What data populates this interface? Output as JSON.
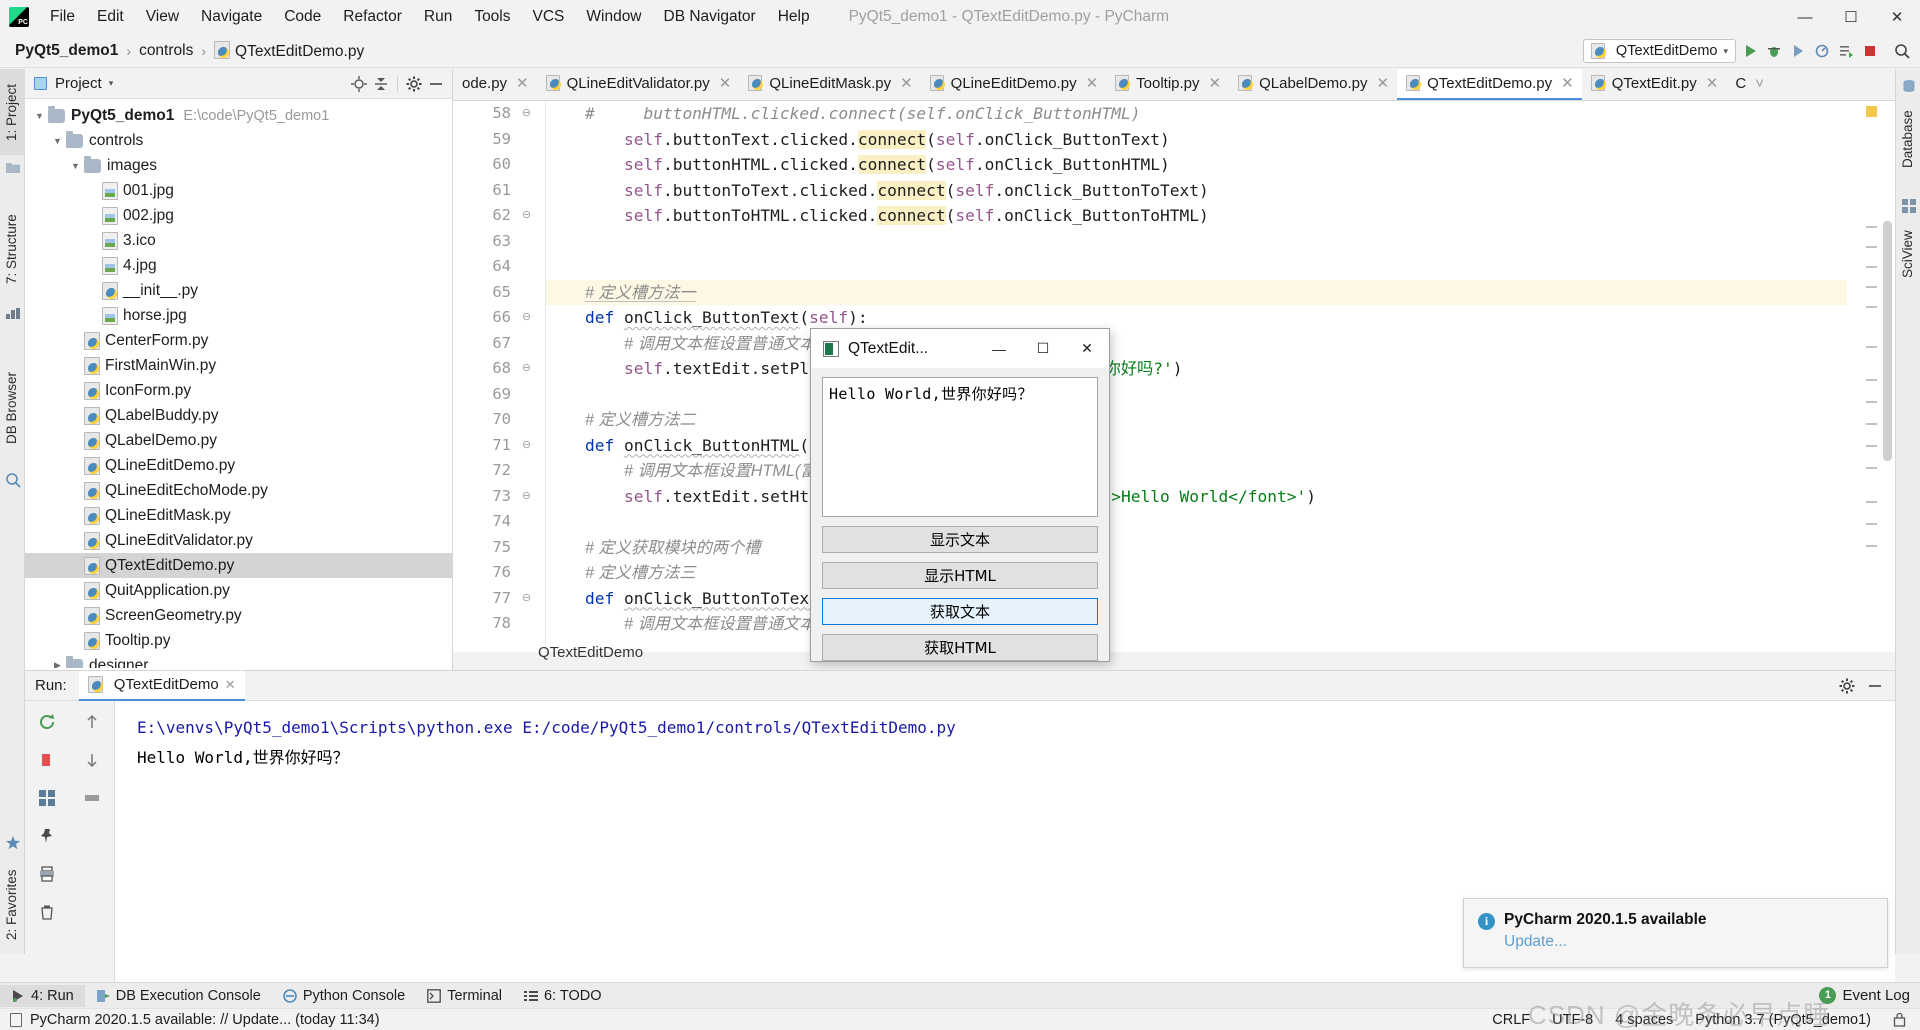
{
  "window": {
    "title": "PyQt5_demo1 - QTextEditDemo.py - PyCharm",
    "minimize": "—",
    "maximize": "☐",
    "close": "✕"
  },
  "menubar": [
    {
      "label": "File"
    },
    {
      "label": "Edit"
    },
    {
      "label": "View"
    },
    {
      "label": "Navigate"
    },
    {
      "label": "Code"
    },
    {
      "label": "Refactor"
    },
    {
      "label": "Run"
    },
    {
      "label": "Tools"
    },
    {
      "label": "VCS"
    },
    {
      "label": "Window"
    },
    {
      "label": "DB Navigator"
    },
    {
      "label": "Help"
    }
  ],
  "breadcrumb": [
    {
      "label": "PyQt5_demo1"
    },
    {
      "label": "controls"
    },
    {
      "label": "QTextEditDemo.py"
    }
  ],
  "toolbar": {
    "run_config": "QTextEditDemo",
    "run_config_caret": "▾"
  },
  "left_strip": {
    "tabs": [
      "1: Project",
      "7: Structure",
      "DB Browser"
    ]
  },
  "right_strip": {
    "tabs": [
      "Database",
      "SciView"
    ]
  },
  "project_panel": {
    "title": "Project",
    "caret": "▾",
    "tree": [
      {
        "indent": 0,
        "twisty": "▼",
        "icon": "folder-icon",
        "label": "PyQt5_demo1",
        "bold": true,
        "path": "E:\\code\\PyQt5_demo1",
        "selected": false
      },
      {
        "indent": 1,
        "twisty": "▼",
        "icon": "folder-icon",
        "label": "controls",
        "bold": false,
        "path": "",
        "selected": false
      },
      {
        "indent": 2,
        "twisty": "▼",
        "icon": "folder-icon",
        "label": "images",
        "bold": false,
        "path": "",
        "selected": false
      },
      {
        "indent": 3,
        "twisty": "",
        "icon": "image-file-icon",
        "label": "001.jpg",
        "bold": false,
        "path": "",
        "selected": false
      },
      {
        "indent": 3,
        "twisty": "",
        "icon": "image-file-icon",
        "label": "002.jpg",
        "bold": false,
        "path": "",
        "selected": false
      },
      {
        "indent": 3,
        "twisty": "",
        "icon": "image-file-icon",
        "label": "3.ico",
        "bold": false,
        "path": "",
        "selected": false
      },
      {
        "indent": 3,
        "twisty": "",
        "icon": "image-file-icon",
        "label": "4.jpg",
        "bold": false,
        "path": "",
        "selected": false
      },
      {
        "indent": 3,
        "twisty": "",
        "icon": "python-file-icon",
        "label": "__init__.py",
        "bold": false,
        "path": "",
        "selected": false
      },
      {
        "indent": 3,
        "twisty": "",
        "icon": "image-file-icon",
        "label": "horse.jpg",
        "bold": false,
        "path": "",
        "selected": false
      },
      {
        "indent": 2,
        "twisty": "",
        "icon": "python-file-icon",
        "label": "CenterForm.py",
        "bold": false,
        "path": "",
        "selected": false
      },
      {
        "indent": 2,
        "twisty": "",
        "icon": "python-file-icon",
        "label": "FirstMainWin.py",
        "bold": false,
        "path": "",
        "selected": false
      },
      {
        "indent": 2,
        "twisty": "",
        "icon": "python-file-icon",
        "label": "IconForm.py",
        "bold": false,
        "path": "",
        "selected": false
      },
      {
        "indent": 2,
        "twisty": "",
        "icon": "python-file-icon",
        "label": "QLabelBuddy.py",
        "bold": false,
        "path": "",
        "selected": false
      },
      {
        "indent": 2,
        "twisty": "",
        "icon": "python-file-icon",
        "label": "QLabelDemo.py",
        "bold": false,
        "path": "",
        "selected": false
      },
      {
        "indent": 2,
        "twisty": "",
        "icon": "python-file-icon",
        "label": "QLineEditDemo.py",
        "bold": false,
        "path": "",
        "selected": false
      },
      {
        "indent": 2,
        "twisty": "",
        "icon": "python-file-icon",
        "label": "QLineEditEchoMode.py",
        "bold": false,
        "path": "",
        "selected": false
      },
      {
        "indent": 2,
        "twisty": "",
        "icon": "python-file-icon",
        "label": "QLineEditMask.py",
        "bold": false,
        "path": "",
        "selected": false
      },
      {
        "indent": 2,
        "twisty": "",
        "icon": "python-file-icon",
        "label": "QLineEditValidator.py",
        "bold": false,
        "path": "",
        "selected": false
      },
      {
        "indent": 2,
        "twisty": "",
        "icon": "python-file-icon",
        "label": "QTextEditDemo.py",
        "bold": false,
        "path": "",
        "selected": true
      },
      {
        "indent": 2,
        "twisty": "",
        "icon": "python-file-icon",
        "label": "QuitApplication.py",
        "bold": false,
        "path": "",
        "selected": false
      },
      {
        "indent": 2,
        "twisty": "",
        "icon": "python-file-icon",
        "label": "ScreenGeometry.py",
        "bold": false,
        "path": "",
        "selected": false
      },
      {
        "indent": 2,
        "twisty": "",
        "icon": "python-file-icon",
        "label": "Tooltip.py",
        "bold": false,
        "path": "",
        "selected": false
      },
      {
        "indent": 1,
        "twisty": "▶",
        "icon": "folder-icon",
        "label": "designer",
        "bold": false,
        "path": "",
        "selected": false
      }
    ]
  },
  "editor_tabs": [
    {
      "label": "ode.py",
      "active": false,
      "partial": true
    },
    {
      "label": "QLineEditValidator.py",
      "active": false,
      "partial": false
    },
    {
      "label": "QLineEditMask.py",
      "active": false,
      "partial": false
    },
    {
      "label": "QLineEditDemo.py",
      "active": false,
      "partial": false
    },
    {
      "label": "Tooltip.py",
      "active": false,
      "partial": false
    },
    {
      "label": "QLabelDemo.py",
      "active": false,
      "partial": false
    },
    {
      "label": "QTextEditDemo.py",
      "active": true,
      "partial": false
    },
    {
      "label": "QTextEdit.py",
      "active": false,
      "partial": false
    },
    {
      "label": "C",
      "active": false,
      "partial": true
    }
  ],
  "editor": {
    "status_label": "QTextEditDemo",
    "lines": [
      {
        "n": 58,
        "fold": "⊖",
        "caret": false
      },
      {
        "n": 59,
        "fold": "",
        "caret": false
      },
      {
        "n": 60,
        "fold": "",
        "caret": false
      },
      {
        "n": 61,
        "fold": "",
        "caret": false
      },
      {
        "n": 62,
        "fold": "⊖",
        "caret": false
      },
      {
        "n": 63,
        "fold": "",
        "caret": false
      },
      {
        "n": 64,
        "fold": "",
        "caret": false
      },
      {
        "n": 65,
        "fold": "",
        "caret": true
      },
      {
        "n": 66,
        "fold": "⊖",
        "caret": false
      },
      {
        "n": 67,
        "fold": "",
        "caret": false
      },
      {
        "n": 68,
        "fold": "⊖",
        "caret": false
      },
      {
        "n": 69,
        "fold": "",
        "caret": false
      },
      {
        "n": 70,
        "fold": "",
        "caret": false
      },
      {
        "n": 71,
        "fold": "⊖",
        "caret": false
      },
      {
        "n": 72,
        "fold": "",
        "caret": false
      },
      {
        "n": 73,
        "fold": "⊖",
        "caret": false
      },
      {
        "n": 74,
        "fold": "",
        "caret": false
      },
      {
        "n": 75,
        "fold": "",
        "caret": false
      },
      {
        "n": 76,
        "fold": "",
        "caret": false
      },
      {
        "n": 77,
        "fold": "⊖",
        "caret": false
      },
      {
        "n": 78,
        "fold": "",
        "caret": false
      }
    ],
    "code_text": {
      "l58": "#     buttonHTML.clicked.connect(self.onClick_ButtonHTML)",
      "l59": "self.buttonText.clicked.connect(self.onClick_ButtonText)",
      "l60": "self.buttonHTML.clicked.connect(self.onClick_ButtonHTML)",
      "l61": "self.buttonToText.clicked.connect(self.onClick_ButtonToText)",
      "l62": "self.buttonToHTML.clicked.connect(self.onClick_ButtonToHTML)",
      "l65": "#  定义槽方法一",
      "l66": "def onClick_ButtonText(self):",
      "l67": "#  调用文本框设置普通文",
      "l68": "self.textEdit.setPl",
      "l68b": "')",
      "l70": "#  定义槽方法二",
      "l71": "def onClick_ButtonHTML(",
      "l72": "#  调用文本框设置HTML(",
      "l73": "self.textEdit.setHt",
      "l73b": "\">Hello World</font>')",
      "l75": "#  定义获取模块的两个槽",
      "l76": "#  定义槽方法三",
      "l77": "def onClick_ButtonToTex",
      "l78": "#  调用文本框设置普通"
    }
  },
  "qt_dialog": {
    "title": "QTextEdit...",
    "minimize": "—",
    "maximize": "☐",
    "close": "✕",
    "textedit_value": "Hello World,世界你好吗？",
    "buttons": [
      {
        "label": "显示文本",
        "focused": false
      },
      {
        "label": "显示HTML",
        "focused": false
      },
      {
        "label": "获取文本",
        "focused": true
      },
      {
        "label": "获取HTML",
        "focused": false
      }
    ]
  },
  "run_panel": {
    "label": "Run:",
    "tab_label": "QTextEditDemo",
    "tab_close": "✕",
    "console_lines": [
      {
        "text": "E:\\venvs\\PyQt5_demo1\\Scripts\\python.exe E:/code/PyQt5_demo1/controls/QTextEditDemo.py",
        "kind": "cmd"
      },
      {
        "text": "Hello World,世界你好吗？",
        "kind": "out"
      }
    ]
  },
  "notification": {
    "title": "PyCharm 2020.1.5 available",
    "link": "Update..."
  },
  "bottom_bar": {
    "items": [
      {
        "label": "4: Run",
        "icon": "run-icon",
        "active": true
      },
      {
        "label": "DB Execution Console",
        "icon": "db-console-icon",
        "active": false
      },
      {
        "label": "Python Console",
        "icon": "python-icon",
        "active": false
      },
      {
        "label": "Terminal",
        "icon": "terminal-icon",
        "active": false
      },
      {
        "label": "6: TODO",
        "icon": "todo-icon",
        "active": false
      }
    ],
    "event_log": "Event Log",
    "event_log_count": "1"
  },
  "status_bar": {
    "message": "PyCharm 2020.1.5 available: // Update... (today 11:34)",
    "line_sep": "CRLF",
    "encoding": "UTF-8",
    "indent": "4 spaces",
    "interpreter": "Python 3.7 (PyQt5_demo1)"
  },
  "watermark": "CSDN @金晚条必早点睡",
  "colors": {
    "accent": "#4a90d9",
    "keyword": "#0033b3",
    "string": "#067d17",
    "comment": "#8c8c8c",
    "self": "#94558d",
    "highlight": "#fbefc4",
    "focus_border": "#0078d7",
    "info": "#3592c4",
    "green": "#499c54"
  }
}
